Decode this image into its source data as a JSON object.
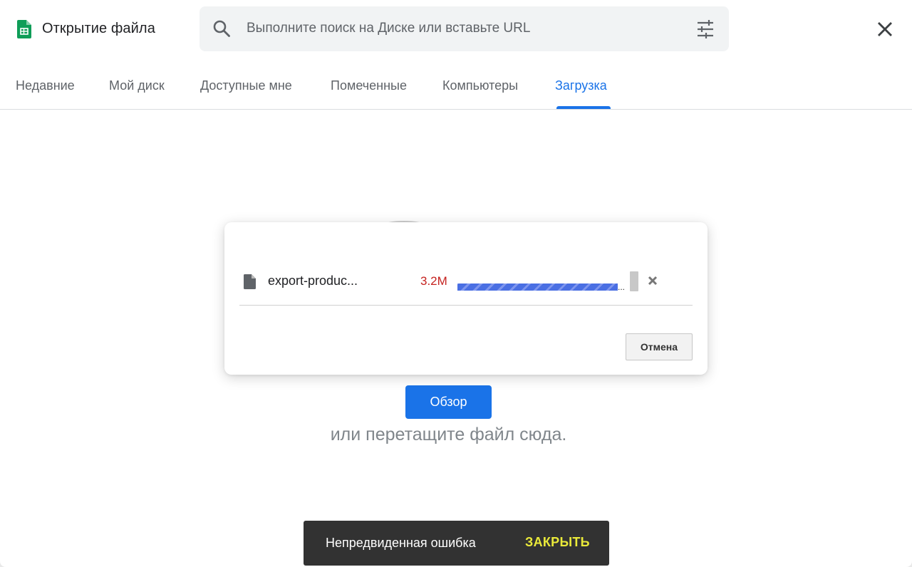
{
  "header": {
    "title": "Открытие файла",
    "app_icon": "google-sheets-icon",
    "search_placeholder": "Выполните поиск на Диске или вставьте URL",
    "search_value": "",
    "close_icon": "close-icon"
  },
  "tabs": [
    {
      "label": "Недавние",
      "active": false
    },
    {
      "label": "Мой диск",
      "active": false
    },
    {
      "label": "Доступные мне",
      "active": false
    },
    {
      "label": "Помеченные",
      "active": false
    },
    {
      "label": "Компьютеры",
      "active": false
    },
    {
      "label": "Загрузка",
      "active": true
    }
  ],
  "upload": {
    "browse_label": "Обзор",
    "drop_hint": "или перетащите файл сюда."
  },
  "upload_dialog": {
    "file_name": "export-produc...",
    "file_size": "3.2M",
    "progress_dots": "...",
    "cancel_label": "Отмена"
  },
  "snackbar": {
    "message": "Непредвиденная ошибка",
    "action_label": "ЗАКРЫТЬ"
  },
  "colors": {
    "accent": "#1a73e8",
    "sheets_green": "#0f9d58",
    "error_red": "#c5221f",
    "snackbar_bg": "#323232",
    "snackbar_action": "#eaea3a"
  }
}
